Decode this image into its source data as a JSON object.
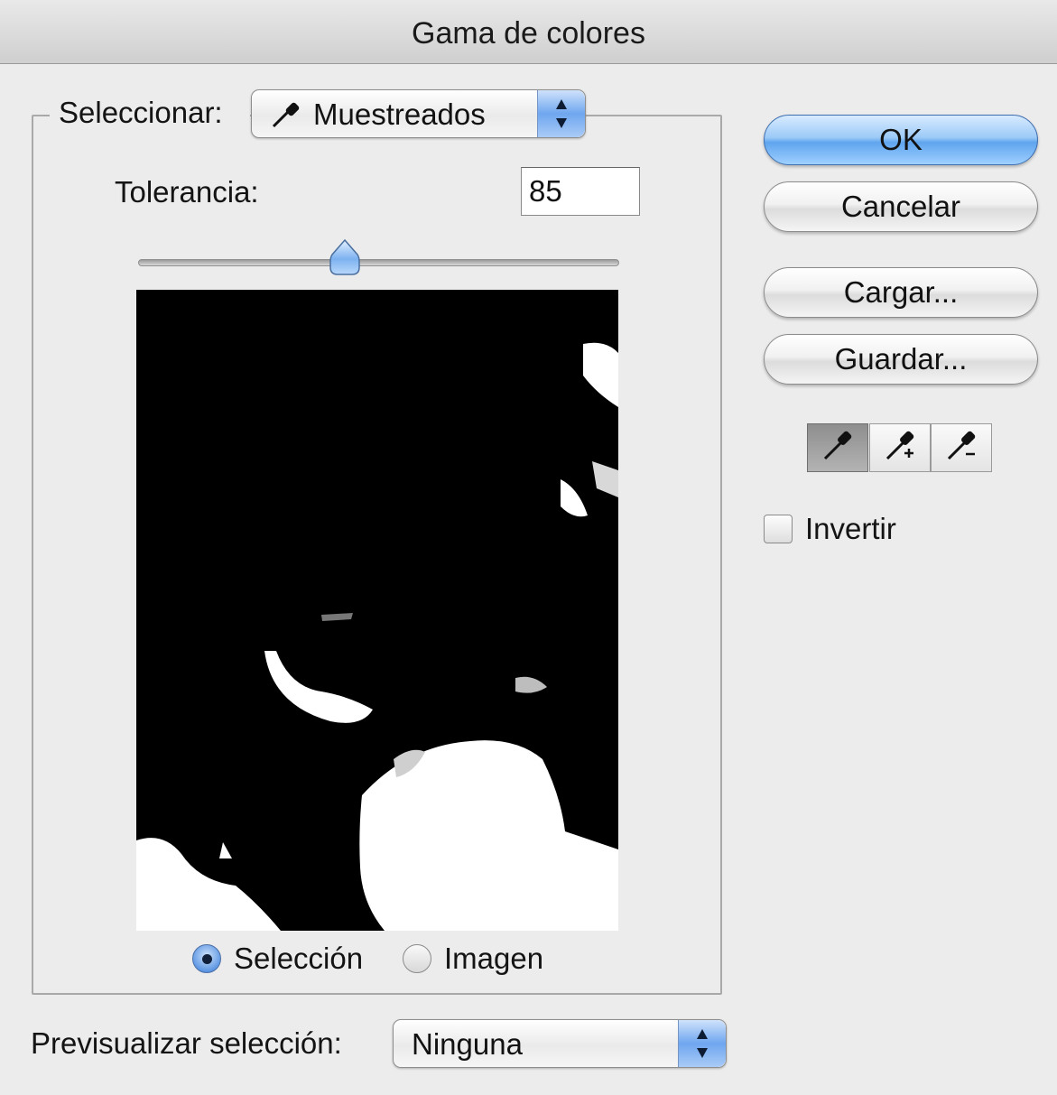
{
  "window": {
    "title": "Gama de colores"
  },
  "select": {
    "label": "Seleccionar:",
    "value": "Muestreados",
    "value_icon": "eyedropper-icon"
  },
  "tolerance": {
    "label": "Tolerancia:",
    "value": "85",
    "slider_level": 0.43
  },
  "view_mode": {
    "selection_label": "Selección",
    "image_label": "Imagen",
    "selected": "Selección"
  },
  "preview_selection": {
    "label": "Previsualizar selección:",
    "value": "Ninguna"
  },
  "buttons": {
    "ok": "OK",
    "cancel": "Cancelar",
    "load": "Cargar...",
    "save": "Guardar..."
  },
  "tools": [
    "eyedropper-icon",
    "eyedropper-plus-icon",
    "eyedropper-minus-icon"
  ],
  "invert": {
    "label": "Invertir",
    "checked": false
  },
  "colors": {
    "accent": "#6fa6ef",
    "background": "#ececec"
  }
}
